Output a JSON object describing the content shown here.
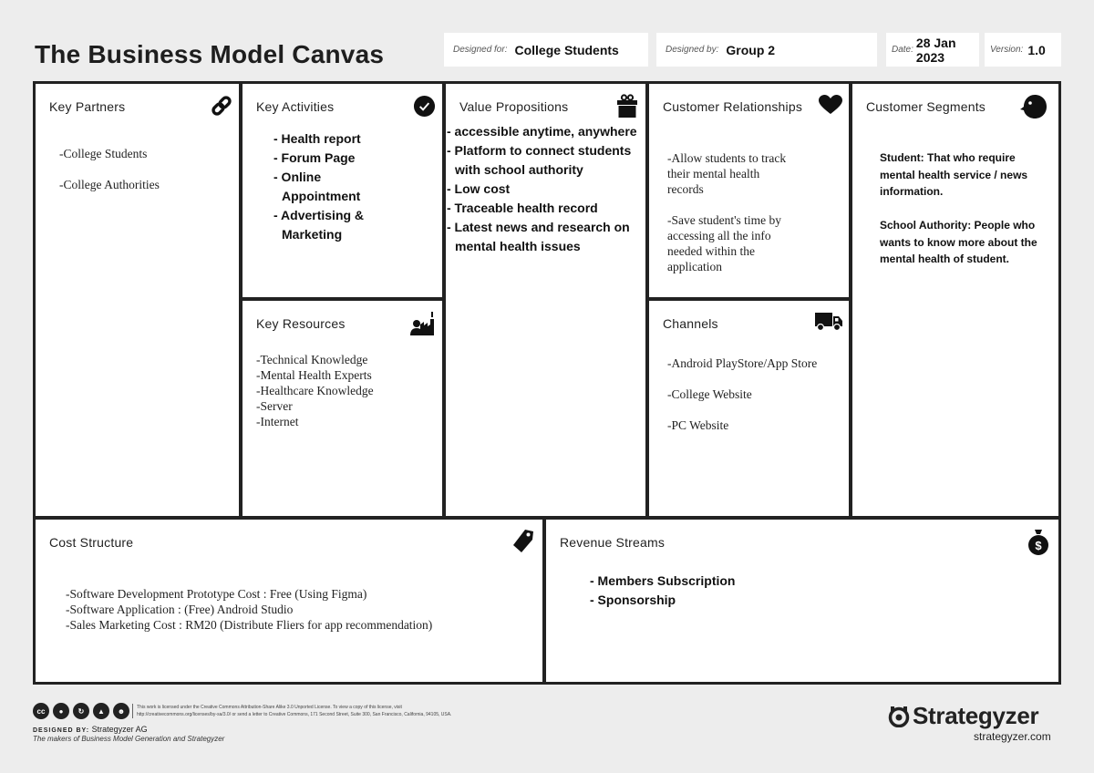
{
  "header": {
    "title": "The Business Model Canvas",
    "designed_for_label": "Designed for:",
    "designed_for_value": "College Students",
    "designed_by_label": "Designed by:",
    "designed_by_value": "Group 2",
    "date_label": "Date:",
    "date_value": "28 Jan 2023",
    "version_label": "Version:",
    "version_value": "1.0"
  },
  "blocks": {
    "key_partners": {
      "title": "Key Partners",
      "icon": "link-icon",
      "items": [
        "-College Students",
        "-College Authorities"
      ]
    },
    "key_activities": {
      "title": "Key Activities",
      "icon": "checkmark-icon",
      "items": [
        "- Health report",
        "- Forum Page",
        "- Online",
        "Appointment",
        "- Advertising &",
        "Marketing"
      ]
    },
    "key_resources": {
      "title": "Key Resources",
      "icon": "factory-worker-icon",
      "items": [
        "-Technical Knowledge",
        "-Mental Health Experts",
        "-Healthcare Knowledge",
        "-Server",
        "-Internet"
      ]
    },
    "value_propositions": {
      "title": "Value Propositions",
      "icon": "gift-icon",
      "items": [
        "- accessible anytime, anywhere",
        "- Platform to connect students",
        "with school authority",
        "- Low cost",
        "- Traceable health record",
        "- Latest news and research on",
        "mental health issues"
      ]
    },
    "customer_relationships": {
      "title": "Customer Relationships",
      "icon": "heart-icon",
      "items": [
        "-Allow students to track",
        "their mental health",
        "records",
        "-Save student's time by",
        "accessing all the info",
        "needed within the",
        "application"
      ]
    },
    "channels": {
      "title": "Channels",
      "icon": "truck-icon",
      "items": [
        "-Android PlayStore/App Store",
        "-College Website",
        "-PC Website"
      ]
    },
    "customer_segments": {
      "title": "Customer Segments",
      "icon": "face-icon",
      "items": [
        "Student: That who require",
        "mental health service / news",
        "information.",
        "School Authority: People who",
        "wants to know more about the",
        "mental health of student."
      ]
    },
    "cost_structure": {
      "title": "Cost Structure",
      "icon": "price-tag-icon",
      "items": [
        "-Software Development Prototype Cost : Free (Using Figma)",
        "-Software Application : (Free) Android Studio",
        "-Sales Marketing Cost : RM20 (Distribute Fliers for app recommendation)"
      ]
    },
    "revenue_streams": {
      "title": "Revenue Streams",
      "icon": "money-bag-icon",
      "items": [
        "- Members Subscription",
        "- Sponsorship"
      ]
    }
  },
  "footer": {
    "cc_icons": [
      "cc",
      "by",
      "sa",
      "nc",
      "person"
    ],
    "license_line1": "This work is licensed under the Creative Commons Attribution-Share Alike 3.0 Unported License. To view a copy of this license, visit",
    "license_line2": "http://creativecommons.org/licenses/by-sa/3.0/ or send a letter to Creative Commons, 171 Second Street, Suite 300, San Francisco, California, 94105, USA.",
    "designed_by_label": "DESIGNED BY:",
    "designed_by_value": "Strategyzer AG",
    "tagline": "The makers of Business Model Generation and Strategyzer",
    "brand": "Strategyzer",
    "brand_url": "strategyzer.com"
  }
}
